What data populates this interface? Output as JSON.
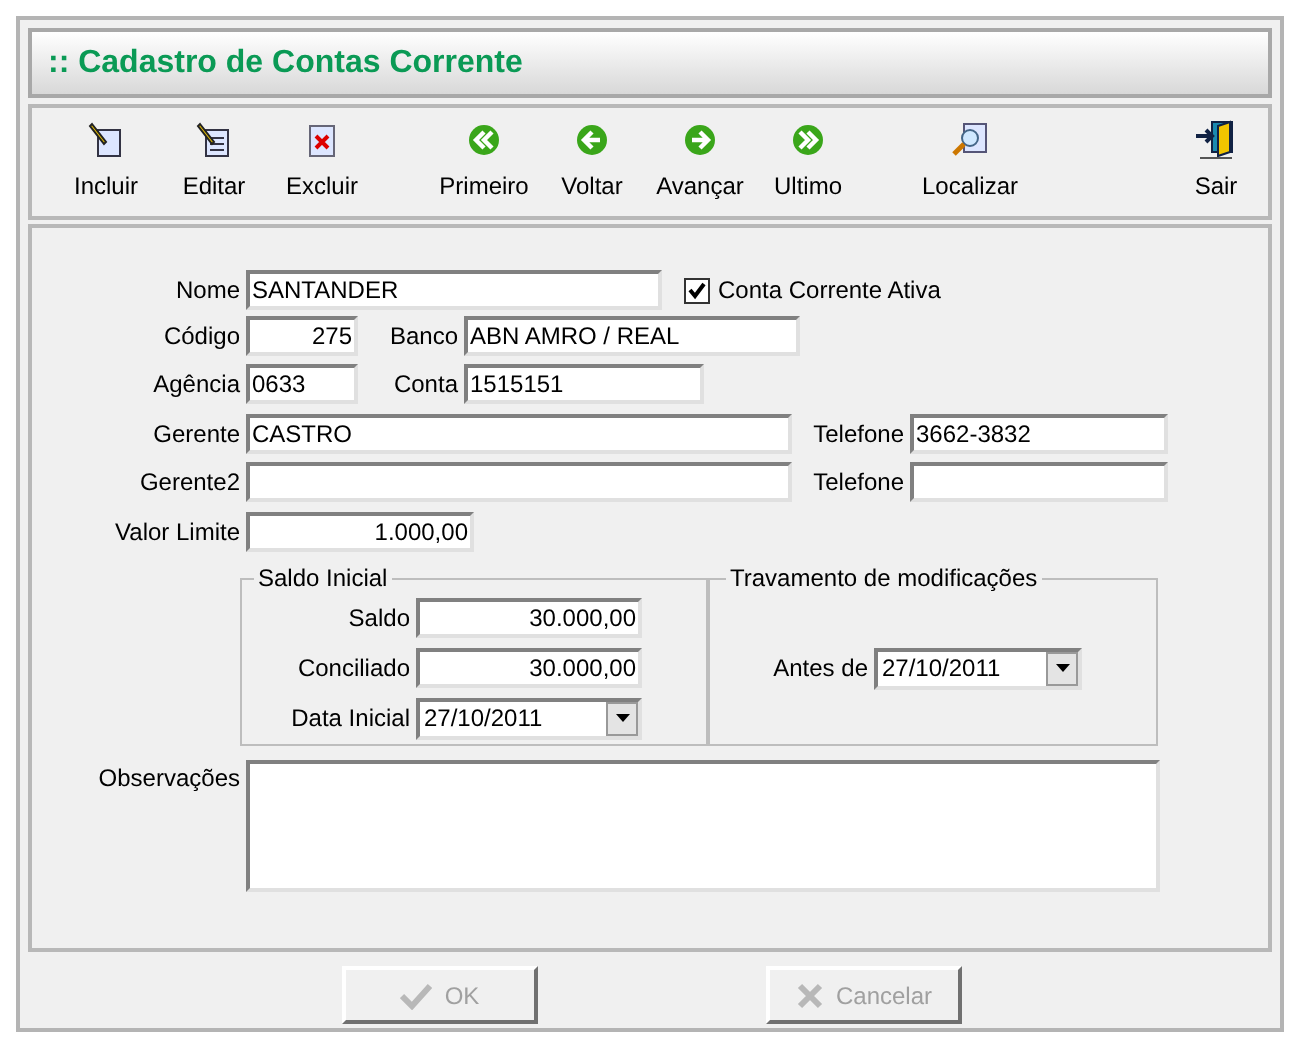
{
  "window": {
    "title": ":: Cadastro de Contas Corrente"
  },
  "toolbar": [
    {
      "label": "Incluir"
    },
    {
      "label": "Editar"
    },
    {
      "label": "Excluir"
    },
    {
      "label": "Primeiro"
    },
    {
      "label": "Voltar"
    },
    {
      "label": "Avançar"
    },
    {
      "label": "Ultimo"
    },
    {
      "label": "Localizar"
    },
    {
      "label": "Sair"
    }
  ],
  "form": {
    "nome": {
      "label": "Nome",
      "value": "SANTANDER"
    },
    "conta_ativa": {
      "label": "Conta Corrente Ativa",
      "checked": true
    },
    "codigo": {
      "label": "Código",
      "value": "275"
    },
    "banco": {
      "label": "Banco",
      "value": "ABN AMRO / REAL"
    },
    "agencia": {
      "label": "Agência",
      "value": "0633"
    },
    "conta": {
      "label": "Conta",
      "value": "1515151"
    },
    "gerente": {
      "label": "Gerente",
      "value": "CASTRO"
    },
    "telefone": {
      "label": "Telefone",
      "value": "3662-3832"
    },
    "gerente2": {
      "label": "Gerente2"
    },
    "telefone2": {
      "label": "Telefone"
    },
    "valor_limite": {
      "label": "Valor Limite",
      "value": "1.000,00"
    },
    "saldo_inicial": {
      "title": "Saldo Inicial",
      "saldo": {
        "label": "Saldo",
        "value": "30.000,00"
      },
      "conciliado": {
        "label": "Conciliado",
        "value": "30.000,00"
      },
      "data_inicial": {
        "label": "Data Inicial",
        "value": "27/10/2011"
      }
    },
    "travamento": {
      "title": "Travamento de modificações",
      "antes_de": {
        "label": "Antes de",
        "value": "27/10/2011"
      }
    },
    "observacoes": {
      "label": "Observações"
    }
  },
  "buttons": [
    {
      "label": "OK",
      "disabled": true
    },
    {
      "label": "Cancelar",
      "disabled": true
    }
  ]
}
